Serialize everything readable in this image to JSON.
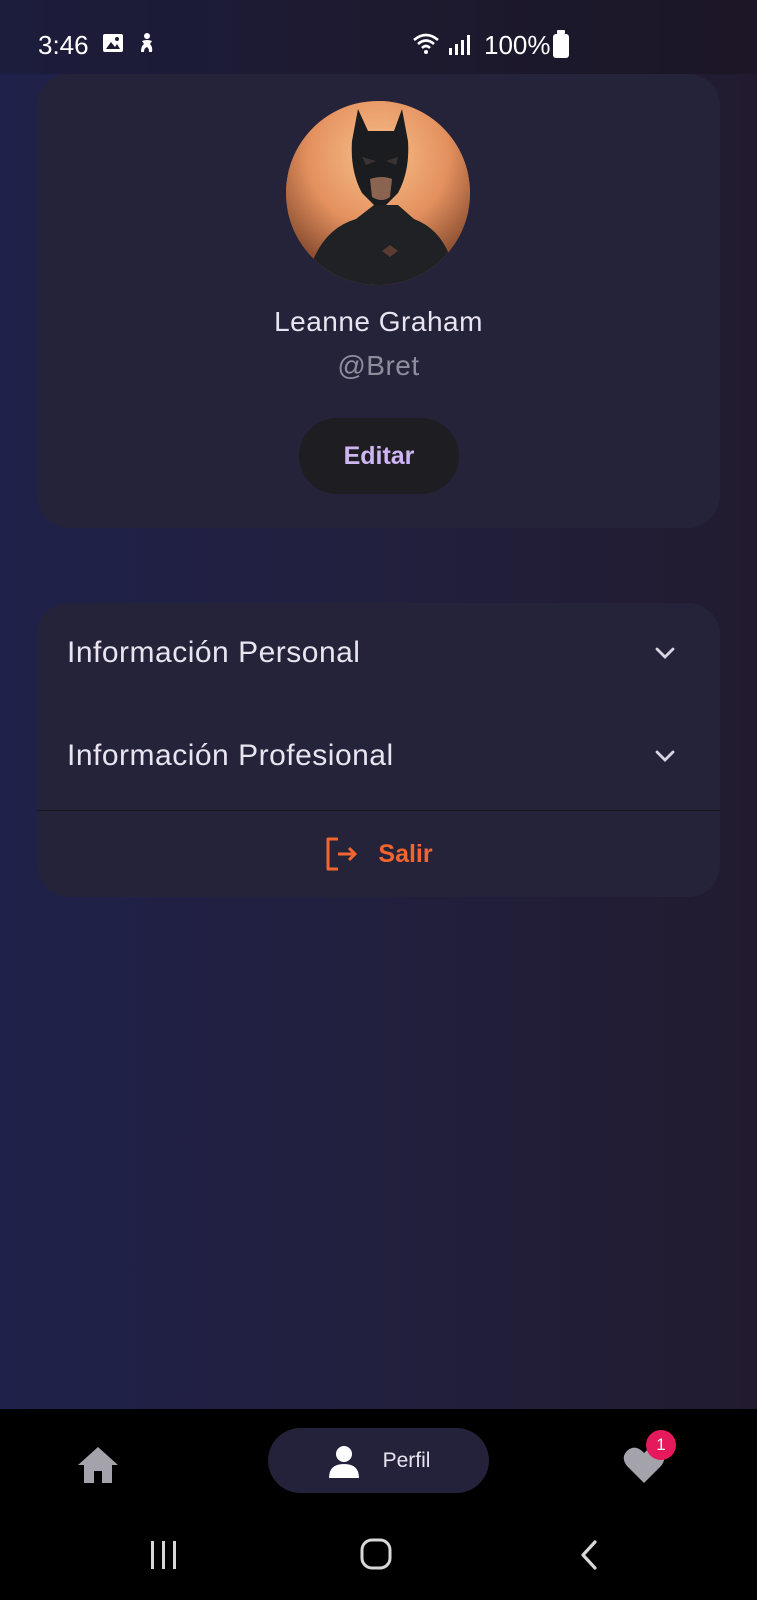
{
  "status_bar": {
    "time": "3:46",
    "battery": "100%",
    "icons": [
      "gallery-icon",
      "accessibility-icon",
      "wifi-icon",
      "signal-icon",
      "battery-icon"
    ]
  },
  "profile": {
    "name": "Leanne Graham",
    "handle": "@Bret",
    "edit_label": "Editar",
    "avatar": "batman-avatar"
  },
  "sections": [
    {
      "label": "Información Personal",
      "icon": "chevron-down-icon"
    },
    {
      "label": "Información Profesional",
      "icon": "chevron-down-icon"
    }
  ],
  "logout": {
    "label": "Salir",
    "icon": "logout-icon"
  },
  "bottom_nav": {
    "items": [
      {
        "icon": "home-icon",
        "label": ""
      },
      {
        "icon": "person-icon",
        "label": "Perfil",
        "active": true
      },
      {
        "icon": "heart-icon",
        "label": "",
        "badge": "1"
      }
    ]
  },
  "colors": {
    "accent": "#cdb6f2",
    "danger": "#f2652e",
    "badge": "#e5195c",
    "card": "#252339"
  }
}
